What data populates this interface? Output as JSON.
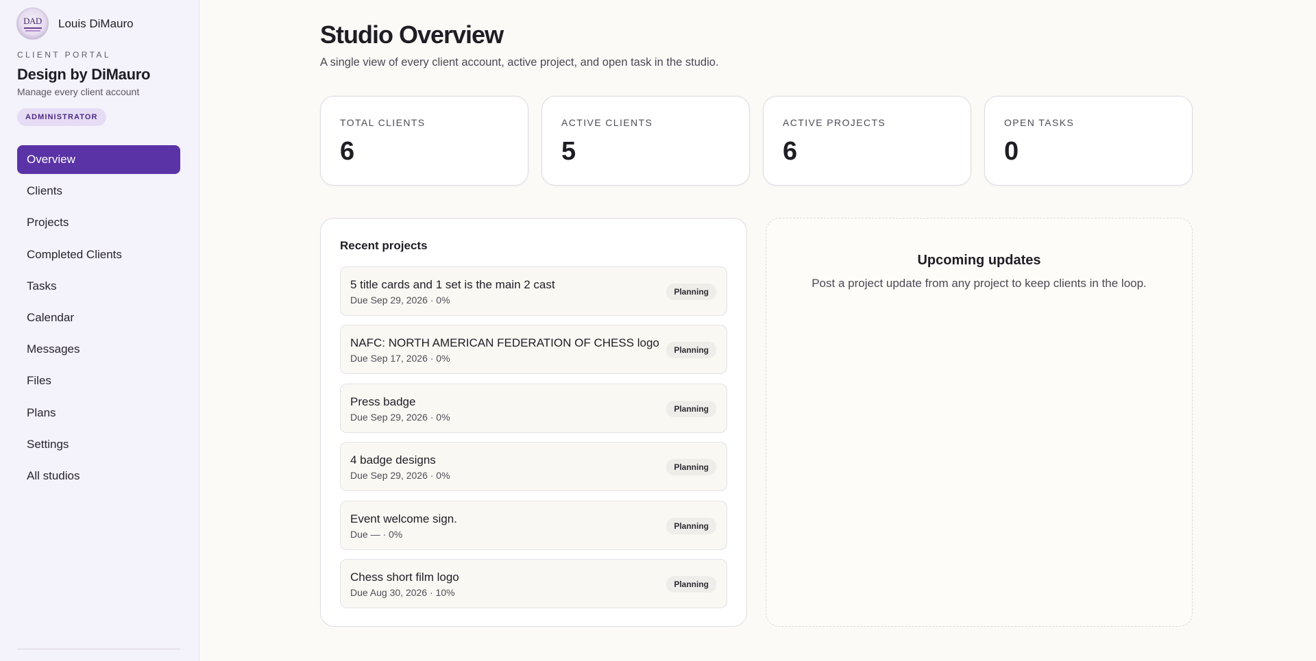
{
  "user": {
    "name": "Louis DiMauro",
    "avatar_monogram": "DAD"
  },
  "sidebar": {
    "portal_label": "CLIENT PORTAL",
    "studio_name": "Design by DiMauro",
    "studio_sub": "Manage every client account",
    "role": "ADMINISTRATOR",
    "nav": [
      {
        "label": "Overview",
        "active": true
      },
      {
        "label": "Clients",
        "active": false
      },
      {
        "label": "Projects",
        "active": false
      },
      {
        "label": "Completed Clients",
        "active": false
      },
      {
        "label": "Tasks",
        "active": false
      },
      {
        "label": "Calendar",
        "active": false
      },
      {
        "label": "Messages",
        "active": false
      },
      {
        "label": "Files",
        "active": false
      },
      {
        "label": "Plans",
        "active": false
      },
      {
        "label": "Settings",
        "active": false
      },
      {
        "label": "All studios",
        "active": false
      }
    ]
  },
  "main": {
    "title": "Studio Overview",
    "subtitle": "A single view of every client account, active project, and open task in the studio.",
    "stats": [
      {
        "label": "TOTAL CLIENTS",
        "value": "6"
      },
      {
        "label": "ACTIVE CLIENTS",
        "value": "5"
      },
      {
        "label": "ACTIVE PROJECTS",
        "value": "6"
      },
      {
        "label": "OPEN TASKS",
        "value": "0"
      }
    ],
    "recent_projects": {
      "heading": "Recent projects",
      "items": [
        {
          "title": "5 title cards and 1 set is the main 2 cast",
          "meta": "Due Sep 29, 2026 · 0%",
          "status": "Planning"
        },
        {
          "title": "NAFC: NORTH AMERICAN FEDERATION OF CHESS logo",
          "meta": "Due Sep 17, 2026 · 0%",
          "status": "Planning"
        },
        {
          "title": "Press badge",
          "meta": "Due Sep 29, 2026 · 0%",
          "status": "Planning"
        },
        {
          "title": "4 badge designs",
          "meta": "Due Sep 29, 2026 · 0%",
          "status": "Planning"
        },
        {
          "title": "Event welcome sign.",
          "meta": "Due — · 0%",
          "status": "Planning"
        },
        {
          "title": "Chess short film logo",
          "meta": "Due Aug 30, 2026 · 10%",
          "status": "Planning"
        }
      ]
    },
    "updates": {
      "title": "Upcoming updates",
      "text": "Post a project update from any project to keep clients in the loop."
    }
  },
  "colors": {
    "accent": "#5a33a6",
    "badge_bg": "#e6dcf4",
    "sidebar_bg": "#f4f2fa",
    "page_bg": "#fbfaf6"
  }
}
